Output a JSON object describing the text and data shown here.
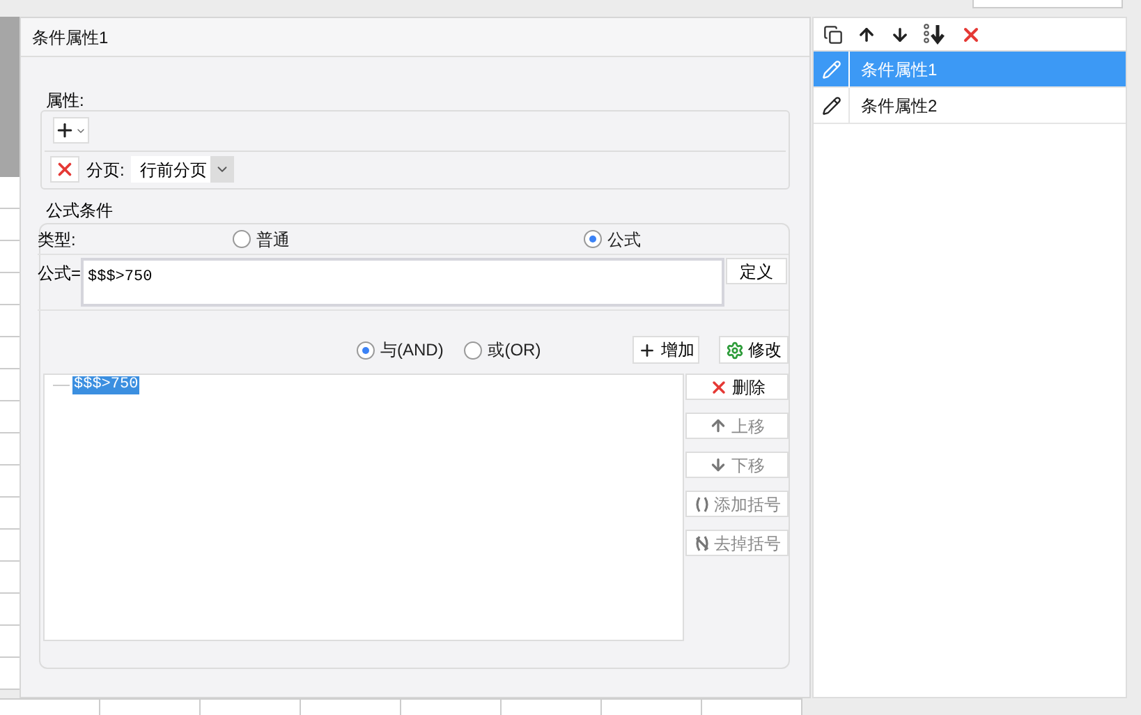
{
  "title": "条件属性1",
  "properties": {
    "label": "属性:",
    "rows": [
      {
        "label": "分页:",
        "value": "行前分页"
      }
    ]
  },
  "formula_condition": {
    "legend": "公式条件",
    "type_label": "类型:",
    "types": [
      {
        "label": "普通",
        "selected": false
      },
      {
        "label": "公式",
        "selected": true
      }
    ],
    "formula_label": "公式=",
    "formula_value": "$$$>750",
    "define_button": "定义",
    "logic": [
      {
        "label": "与(AND)",
        "selected": true
      },
      {
        "label": "或(OR)",
        "selected": false
      }
    ],
    "add_button": "增加",
    "modify_button": "修改",
    "conditions": [
      {
        "text": "$$$>750",
        "selected": true
      }
    ],
    "side_buttons": [
      {
        "kind": "delete",
        "label": "删除",
        "disabled": false
      },
      {
        "kind": "up",
        "label": "上移",
        "disabled": true
      },
      {
        "kind": "down",
        "label": "下移",
        "disabled": true
      },
      {
        "kind": "add-paren",
        "label": "添加括号",
        "disabled": true
      },
      {
        "kind": "remove-paren",
        "label": "去掉括号",
        "disabled": true
      }
    ]
  },
  "condition_list": {
    "items": [
      {
        "label": "条件属性1",
        "selected": true
      },
      {
        "label": "条件属性2",
        "selected": false
      }
    ]
  }
}
